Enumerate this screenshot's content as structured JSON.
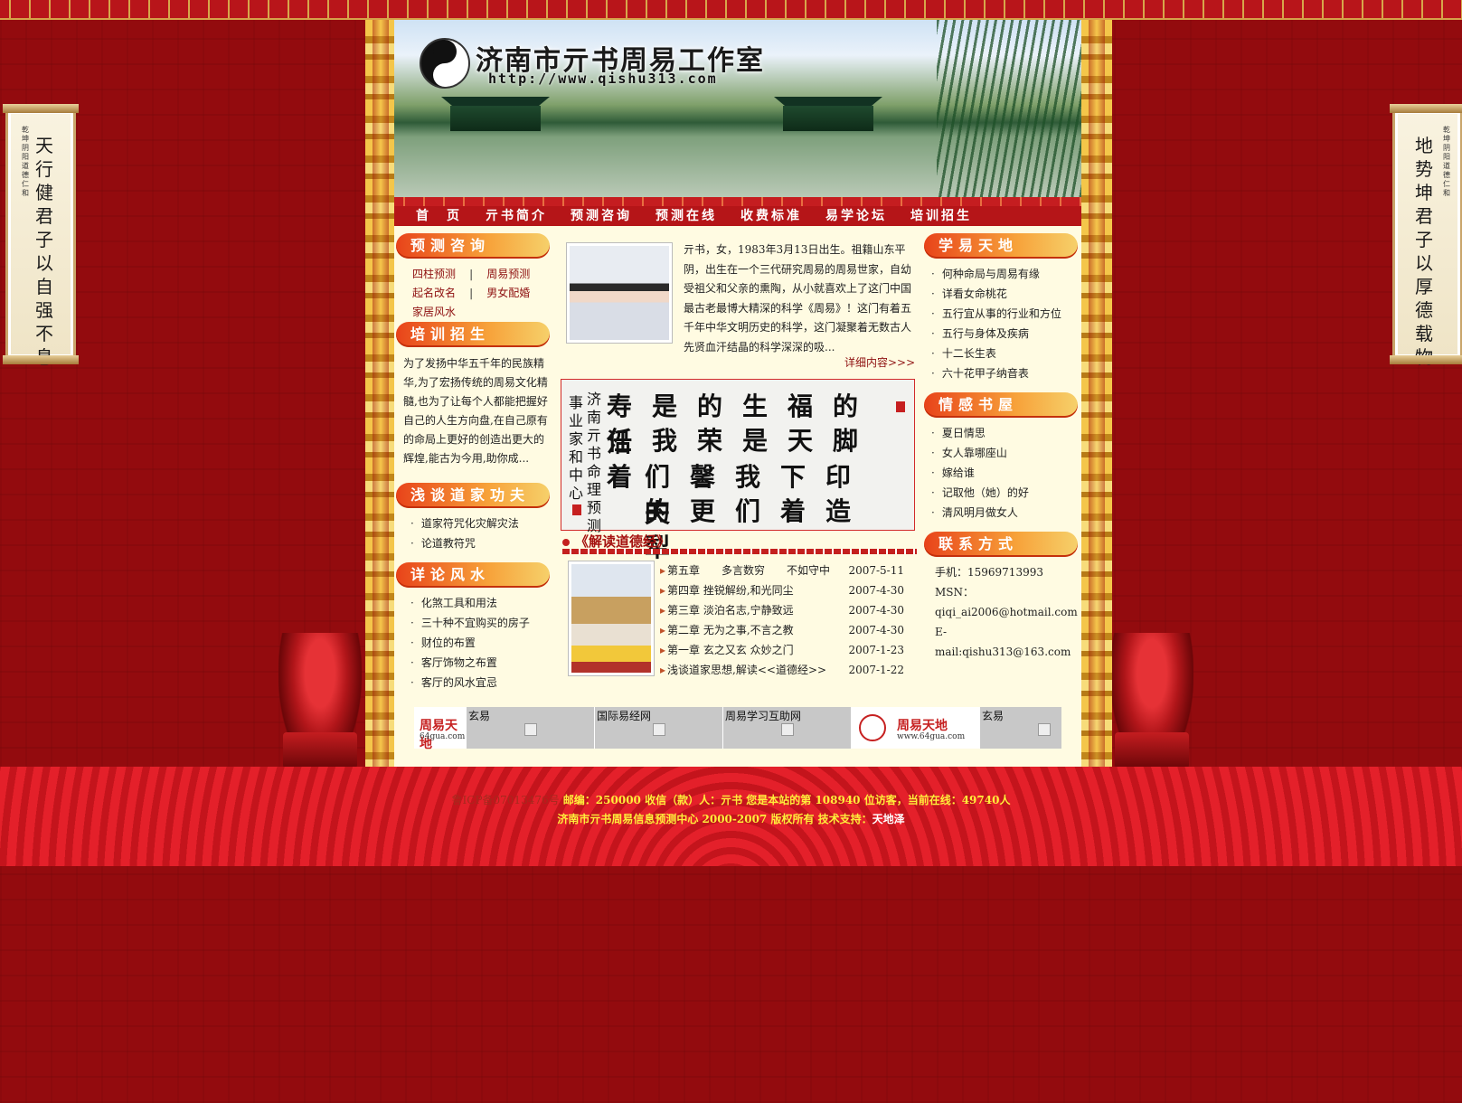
{
  "banner": {
    "title": "济南市亓书周易工作室",
    "url": "http://www.qishu313.com"
  },
  "scrolls": {
    "left": {
      "main": "天行健 君子以自强不息",
      "small": "乾坤阴阳 道德仁和"
    },
    "right": {
      "main": "地势坤 君子以厚德载物",
      "small": "乾坤阴阳 道德仁和"
    }
  },
  "nav": [
    "首　页",
    "亓书简介",
    "预测咨询",
    "预测在线",
    "收费标准",
    "易学论坛",
    "培训招生"
  ],
  "left": {
    "consult": {
      "title": "预测咨询",
      "links": [
        "四柱预测",
        "周易预测",
        "起名改名",
        "男女配婚",
        "家居风水"
      ],
      "sep": "|"
    },
    "training": {
      "title": "培训招生",
      "text": "为了发扬中华五千年的民族精华,为了宏扬传统的周易文化精髓,也为了让每个人都能把握好自己的人生方向盘,在自己原有的命局上更好的创造出更大的辉煌,能古为今用,助你成..."
    },
    "taoism": {
      "title": "浅谈道家功夫",
      "items": [
        "道家符咒化灾解灾法",
        "论道教符咒"
      ]
    },
    "fengshui": {
      "title": "详论风水",
      "items": [
        "化煞工具和用法",
        "三十种不宜购买的房子",
        "财位的布置",
        "客厅饰物之布置",
        "客厅的风水宜忌"
      ]
    }
  },
  "center": {
    "intro": "亓书，女，1983年3月13日出生。祖籍山东平阴，出生在一个三代研究周易的周易世家，自幼受祖父和父亲的熏陶，从小就喜欢上了这门中国最古老最博大精深的科学《周易》！这门有着五千年中华文明历史的科学，这门凝聚着无数古人先贤血汗结晶的科学深深的吸...",
    "more": "详细内容>>>",
    "calligraphy": {
      "rows": [
        "寿是的生福的沿",
        "任我荣是天脚着",
        "们馨我下印夫",
        "的更们着造犁"
      ],
      "side1": "济南亓书命理预测",
      "side2": "事业家和中心"
    },
    "dao": {
      "title": "《解读道德经》",
      "chapters": [
        {
          "title": "第五章　　多言数穷　　不如守中",
          "date": "2007-5-11"
        },
        {
          "title": "第四章  挫锐解纷,和光同尘",
          "date": "2007-4-30"
        },
        {
          "title": "第三章  淡泊名志,宁静致远",
          "date": "2007-4-30"
        },
        {
          "title": "第二章  无为之事,不言之教",
          "date": "2007-4-30"
        },
        {
          "title": "第一章  玄之又玄 众妙之门",
          "date": "2007-1-23"
        },
        {
          "title": "浅谈道家思想,解读<<道德经>>",
          "date": "2007-1-22"
        }
      ]
    }
  },
  "right": {
    "learn": {
      "title": "学易天地",
      "items": [
        "何种命局与周易有缘",
        "详看女命桃花",
        "五行宜从事的行业和方位",
        "五行与身体及疾病",
        "十二长生表",
        "六十花甲子纳音表"
      ]
    },
    "emotion": {
      "title": "情感书屋",
      "items": [
        "夏日情思",
        "女人靠哪座山",
        "嫁给谁",
        "记取他（她）的好",
        "清风明月做女人"
      ]
    },
    "contact": {
      "title": "联系方式",
      "phone": "手机：15969713993",
      "msn_label": "MSN：",
      "msn": "qiqi_ai2006@hotmail.com",
      "email": "E-mail:qishu313@163.com"
    }
  },
  "links": {
    "logo1_title": "周易天地",
    "logo1_sub": "64gua.com",
    "cell1": "玄易",
    "cell2": "国际易经网",
    "cell3": "周易学习互助网",
    "logo2_title": "周易天地",
    "logo2_sub": "www.64gua.com",
    "cell4": "玄易"
  },
  "footer": {
    "icp": "鲁ICP备07013476号",
    "line1": "邮编：250000 收信（款）人：亓书 您是本站的第 108940 位访客，当前在线：49740人",
    "line2a": "济南市亓书周易信息预测中心 2000-2007 版权所有 技术支持：",
    "line2b": "天地泽"
  }
}
